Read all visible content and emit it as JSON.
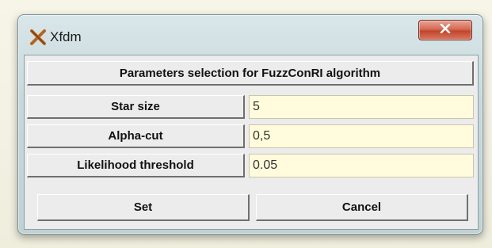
{
  "window": {
    "title": "Xfdm"
  },
  "dialog": {
    "heading": "Parameters selection for FuzzConRI algorithm",
    "fields": [
      {
        "label": "Star size",
        "value": "5"
      },
      {
        "label": "Alpha-cut",
        "value": "0,5"
      },
      {
        "label": "Likelihood threshold",
        "value": "0.05"
      }
    ],
    "set_label": "Set",
    "cancel_label": "Cancel"
  },
  "colors": {
    "field_background": "#fffbdc",
    "close_button": "#c2452b",
    "app_icon": "#b5651d"
  },
  "icons": {
    "app": "x-logo-icon",
    "close": "close-icon"
  }
}
